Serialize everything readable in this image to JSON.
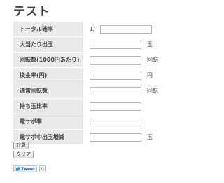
{
  "page": {
    "title": "テスト"
  },
  "form": {
    "rows": [
      {
        "label": "トータル確率",
        "prefix": "1/",
        "value": "",
        "unit": ""
      },
      {
        "label": "大当たり出玉",
        "prefix": "",
        "value": "",
        "unit": "玉"
      },
      {
        "label": "回転数(1000円あたり)",
        "prefix": "",
        "value": "",
        "unit": "回転"
      },
      {
        "label": "換金率(円)",
        "prefix": "",
        "value": "",
        "unit": "円"
      },
      {
        "label": "通常回転数",
        "prefix": "",
        "value": "",
        "unit": "回転"
      },
      {
        "label": "持ち玉比率",
        "prefix": "",
        "value": "",
        "unit": ""
      },
      {
        "label": "電サポ率",
        "prefix": "",
        "value": "",
        "unit": ""
      },
      {
        "label": "電サポ中出玉増減",
        "prefix": "",
        "value": "",
        "unit": "玉"
      }
    ]
  },
  "buttons": {
    "calc_label": "計算",
    "clear_label": "クリア"
  },
  "social": {
    "tweet_label": "Tweet",
    "tweet_count": "0",
    "accent_color": "#1d9bf0"
  }
}
